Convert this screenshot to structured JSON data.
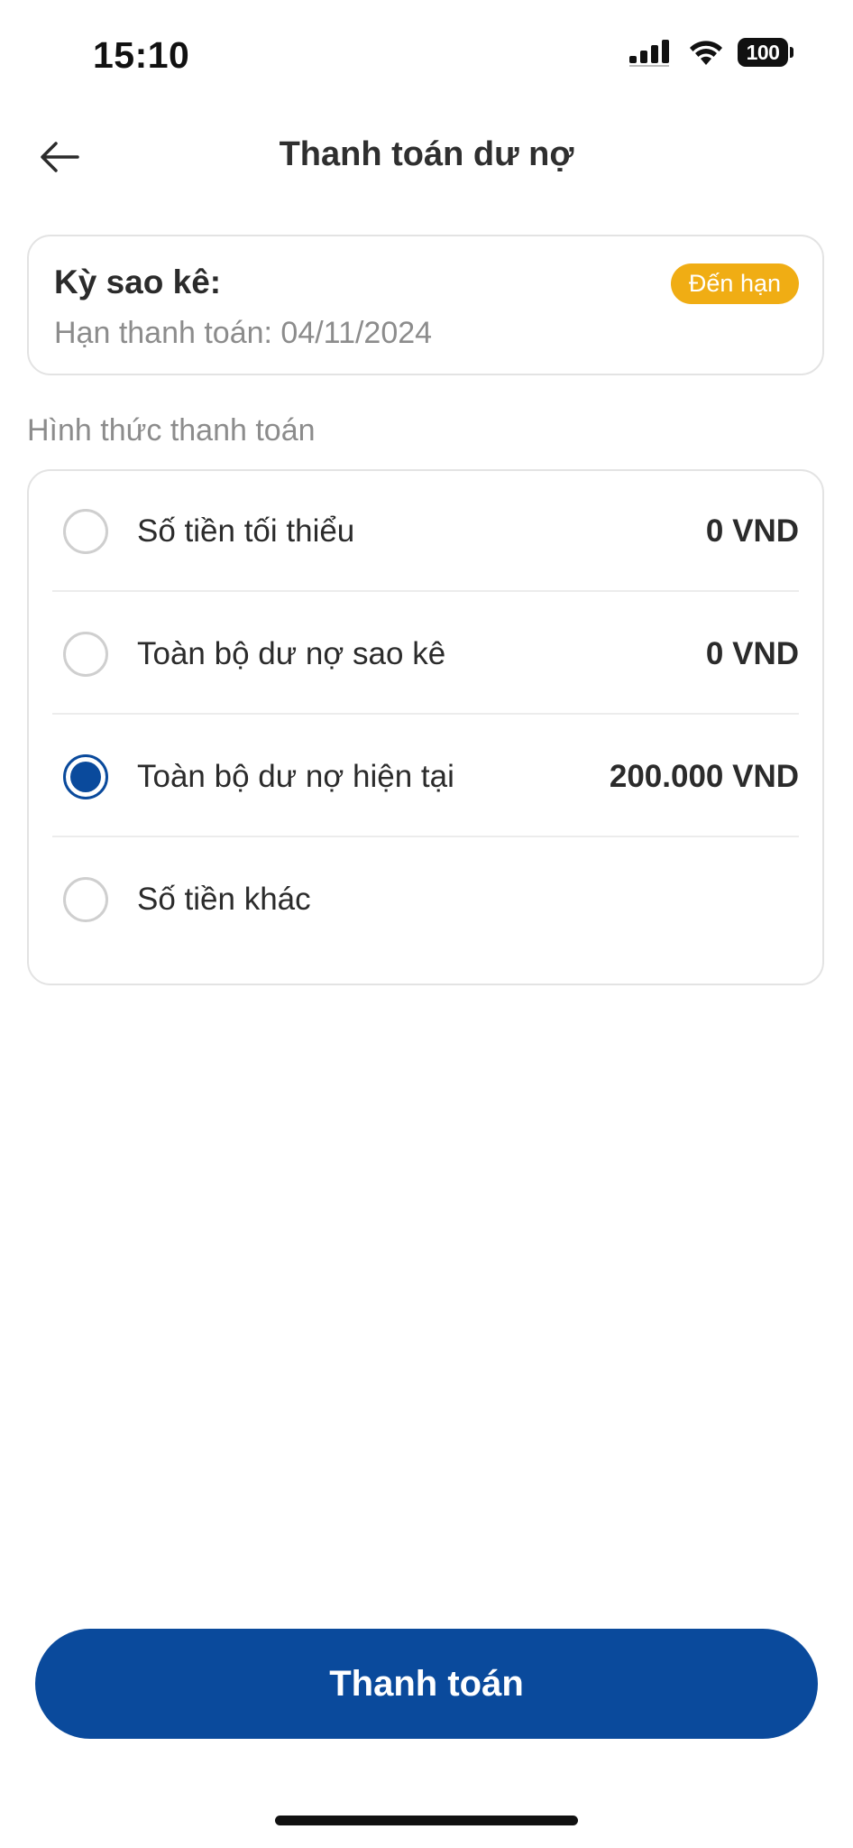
{
  "status_bar": {
    "time": "15:10",
    "battery": "100"
  },
  "header": {
    "title": "Thanh toán dư nợ",
    "back_icon": "arrow-left-icon"
  },
  "statement": {
    "title": "Kỳ sao kê:",
    "badge": "Đến hạn",
    "due_line": "Hạn thanh toán: 04/11/2024",
    "badge_color": "#f0ad14"
  },
  "payment_method": {
    "label": "Hình thức thanh toán",
    "options": [
      {
        "label": "Số tiền tối thiểu",
        "amount": "0 VND",
        "selected": false
      },
      {
        "label": "Toàn bộ dư nợ sao kê",
        "amount": "0 VND",
        "selected": false
      },
      {
        "label": "Toàn bộ dư nợ hiện tại",
        "amount": "200.000 VND",
        "selected": true
      },
      {
        "label": "Số tiền khác",
        "amount": "",
        "selected": false
      }
    ]
  },
  "actions": {
    "pay_label": "Thanh toán",
    "primary_color": "#0a4a9c"
  }
}
